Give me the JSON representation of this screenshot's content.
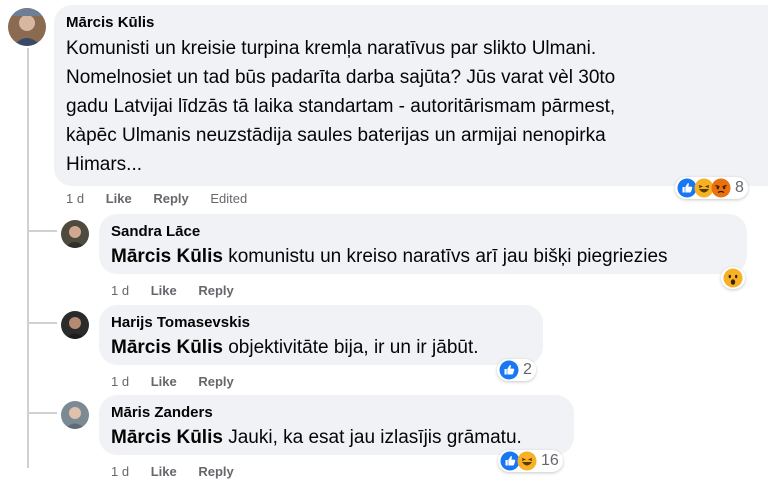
{
  "comments": [
    {
      "author": "Mārcis Kūlis",
      "lines": [
        "Komunisti un kreisie turpina kremļa naratīvus par slikto Ulmani.",
        "Nomelnosiet un tad būs padarīta darba sajūta? Jūs varat vèl 30to",
        "gadu Latvijai līdzās tā laika standartam - autoritārismam pārmest,",
        "kàpēc Ulmanis neuzstādija saules baterijas un armijai nenopirka",
        "Himars..."
      ],
      "time": "1 d",
      "like": "Like",
      "reply": "Reply",
      "edited": "Edited",
      "reactions": {
        "icons": [
          "like-icon",
          "haha-icon",
          "angry-icon"
        ],
        "count": "8"
      }
    },
    {
      "author": "Sandra Lāce",
      "mention": "Mārcis Kūlis",
      "text": "komunistu un kreiso naratīvs arī jau bišķi piegriezies",
      "time": "1 d",
      "like": "Like",
      "reply": "Reply",
      "reactions": {
        "icons": [
          "wow-icon"
        ],
        "count": ""
      }
    },
    {
      "author": "Harijs Tomasevskis",
      "mention": "Mārcis Kūlis",
      "text": "objektivitāte bija, ir un ir jābūt.",
      "time": "1 d",
      "like": "Like",
      "reply": "Reply",
      "reactions": {
        "icons": [
          "like-icon"
        ],
        "count": "2"
      }
    },
    {
      "author": "Māris Zanders",
      "mention": "Mārcis Kūlis",
      "text": "Jauki, ka esat jau izlasījis grāmatu.",
      "time": "1 d",
      "like": "Like",
      "reply": "Reply",
      "reactions": {
        "icons": [
          "like-icon",
          "haha-icon"
        ],
        "count": "16"
      }
    }
  ],
  "colors": {
    "bubble": "#f0f2f5",
    "meta_text": "#65676b",
    "like_blue": "#1877f2",
    "emoji_yellow": "#f7b125",
    "angry_red": "#e9710f"
  }
}
